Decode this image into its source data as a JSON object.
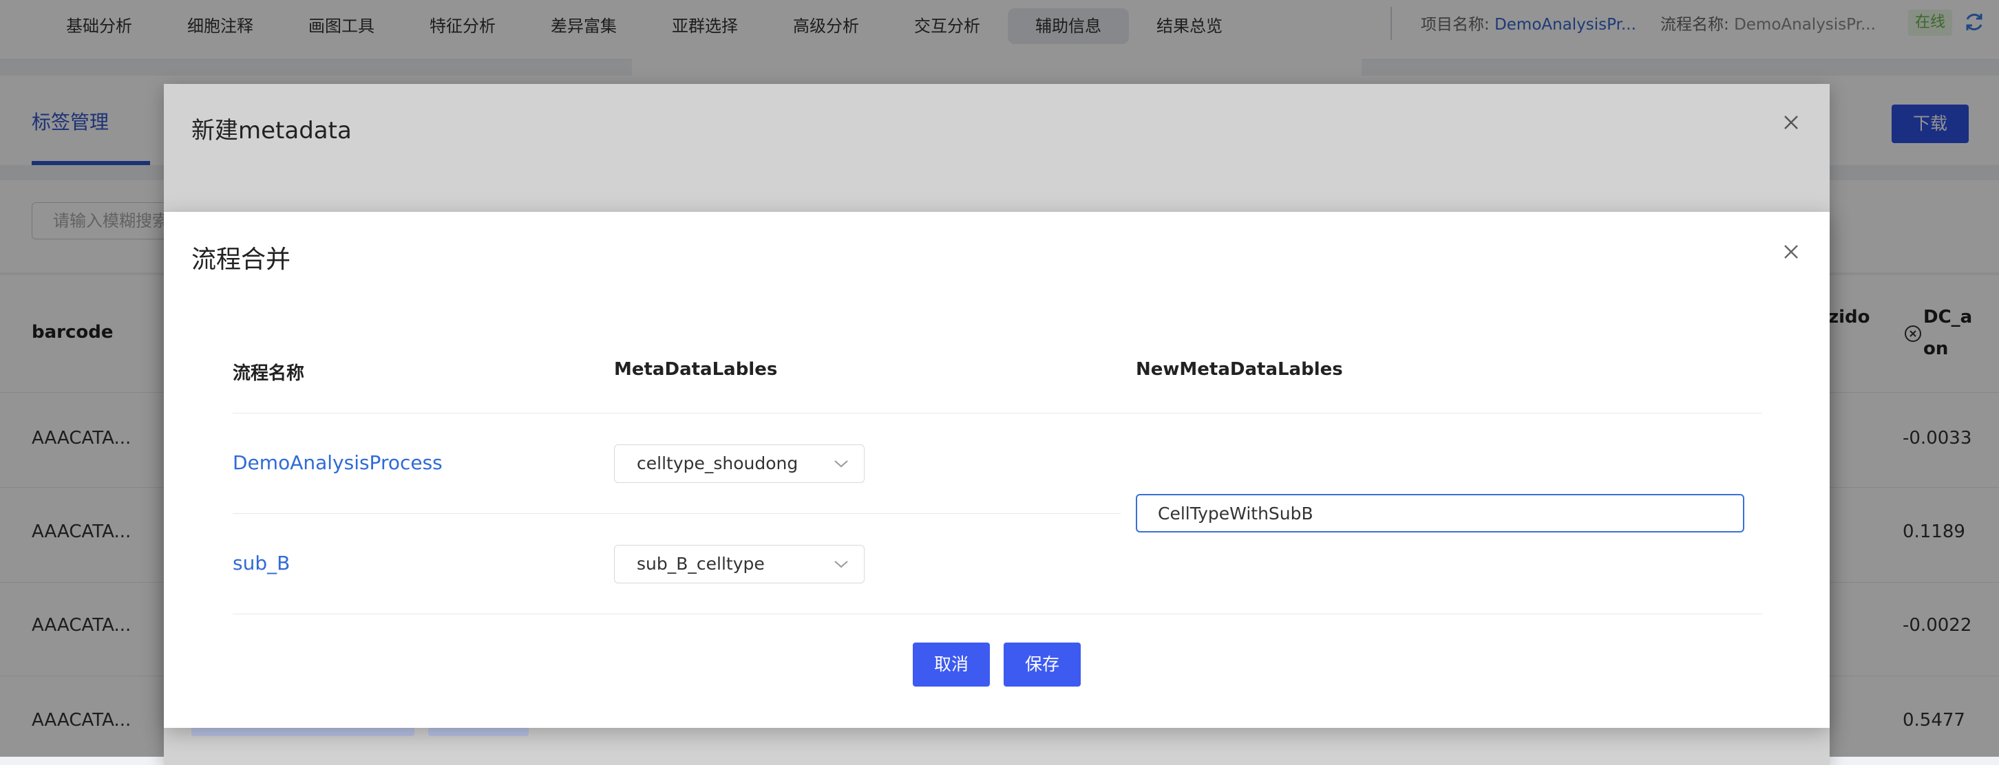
{
  "nav": {
    "items": [
      {
        "label": "基础分析"
      },
      {
        "label": "细胞注释"
      },
      {
        "label": "画图工具"
      },
      {
        "label": "特征分析"
      },
      {
        "label": "差异富集"
      },
      {
        "label": "亚群选择"
      },
      {
        "label": "高级分析"
      },
      {
        "label": "交互分析"
      },
      {
        "label": "辅助信息"
      },
      {
        "label": "结果总览"
      }
    ],
    "active": "辅助信息",
    "project_label": "项目名称: ",
    "project_value": "DemoAnalysisPr...",
    "process_label": "流程名称: ",
    "process_value": "DemoAnalysisPr...",
    "status": "在线",
    "status_color": "#67b34a",
    "refresh_icon": "refresh-icon"
  },
  "background_page": {
    "tab_label": "标签管理",
    "search_placeholder": "请输入模糊搜索",
    "download_label": "下载",
    "table_header": "barcode",
    "rows": [
      {
        "barcode": "AAACATA...",
        "value": "-0.0033"
      },
      {
        "barcode": "AAACATA...",
        "value": "0.1189"
      },
      {
        "barcode": "AAACATA...",
        "value": "-0.0022"
      },
      {
        "barcode": "AAACATA...",
        "value": "0.5477"
      }
    ],
    "right_header_1": "zido",
    "right_header_2a": "DC_a",
    "right_header_2b": "on"
  },
  "back_modal": {
    "title": "新建metadata"
  },
  "modal": {
    "title": "流程合并",
    "columns": {
      "process": "流程名称",
      "labels": "MetaDataLables",
      "new_labels": "NewMetaDataLables"
    },
    "rows": [
      {
        "process": "DemoAnalysisProcess",
        "label": "celltype_shoudong"
      },
      {
        "process": "sub_B",
        "label": "sub_B_celltype"
      }
    ],
    "new_label_value": "CellTypeWithSubB",
    "cancel_label": "取消",
    "save_label": "保存",
    "accent_color": "#3d5af1",
    "link_color": "#2f6bd6"
  }
}
